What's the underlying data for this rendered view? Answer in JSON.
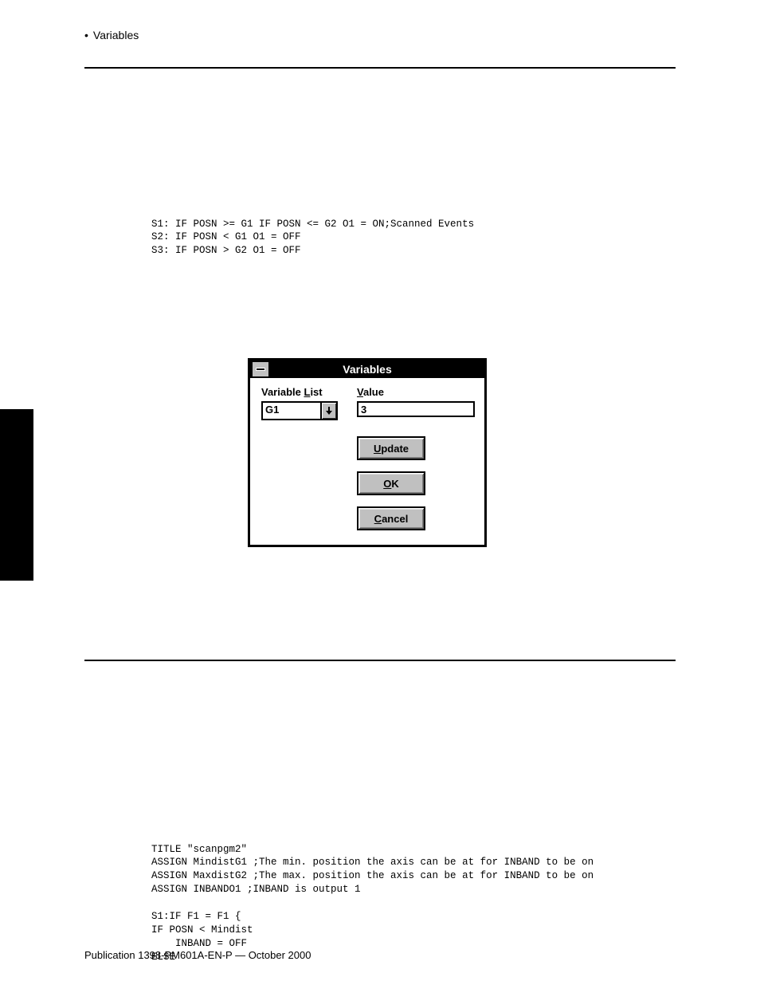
{
  "header": {
    "bullet": "•",
    "section": "Variables"
  },
  "code_top": "S1: IF POSN >= G1 IF POSN <= G2 O1 = ON;Scanned Events\nS2: IF POSN < G1 O1 = OFF\nS3: IF POSN > G2 O1 = OFF",
  "dialog": {
    "title": "Variables",
    "variable_list": {
      "label_pre": "Variable ",
      "label_mn": "L",
      "label_post": "ist",
      "value": "G1"
    },
    "value": {
      "label_mn": "V",
      "label_post": "alue",
      "value": "3"
    },
    "buttons": {
      "update_mn": "U",
      "update_post": "pdate",
      "ok_mn": "O",
      "ok_post": "K",
      "cancel_mn": "C",
      "cancel_post": "ancel"
    }
  },
  "code_bottom": "TITLE \"scanpgm2\"\nASSIGN MindistG1 ;The min. position the axis can be at for INBAND to be on\nASSIGN MaxdistG2 ;The max. position the axis can be at for INBAND to be on\nASSIGN INBANDO1 ;INBAND is output 1\n\nS1:IF F1 = F1 {\nIF POSN < Mindist\n    INBAND = OFF\nELSE",
  "footer": "Publication 1398-PM601A-EN-P — October 2000"
}
